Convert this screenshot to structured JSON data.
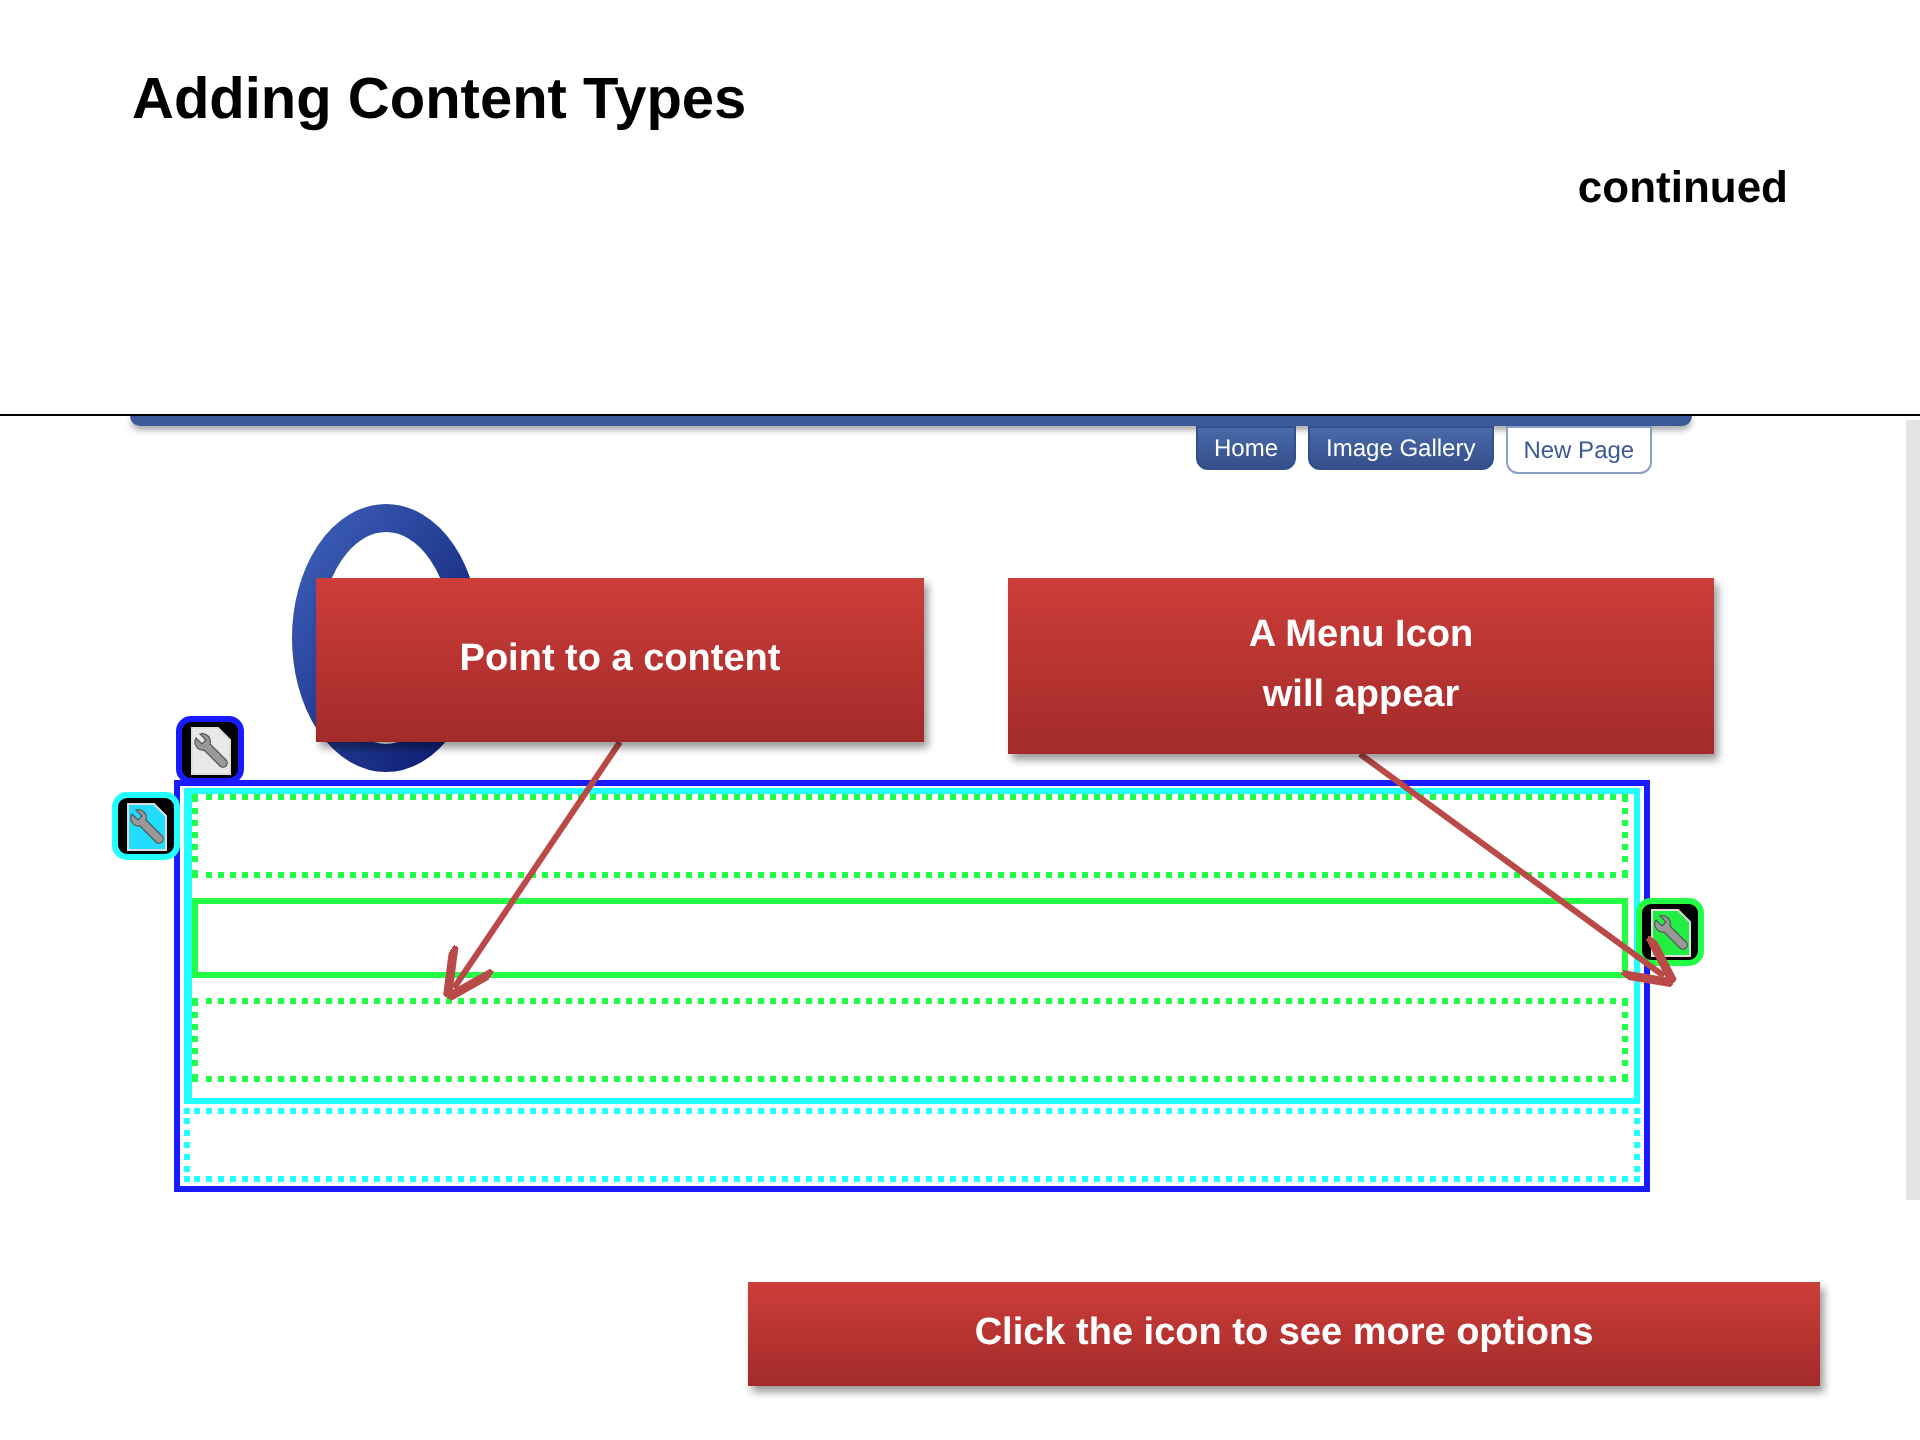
{
  "slide": {
    "title": "Adding Content Types",
    "subtitle": "continued"
  },
  "site": {
    "nav_tabs": [
      {
        "label": "Home",
        "selected": false
      },
      {
        "label": "Image Gallery",
        "selected": false
      },
      {
        "label": "New Page",
        "selected": true
      }
    ]
  },
  "editor": {
    "rows": [
      {
        "hovered": false
      },
      {
        "hovered": true
      },
      {
        "hovered": false
      }
    ]
  },
  "callouts": [
    {
      "kind": "top-left",
      "text": "Point to a content"
    },
    {
      "kind": "top-right",
      "text": "A Menu Icon\nwill appear"
    },
    {
      "kind": "bottom",
      "text": "Click the icon to see more options"
    }
  ]
}
